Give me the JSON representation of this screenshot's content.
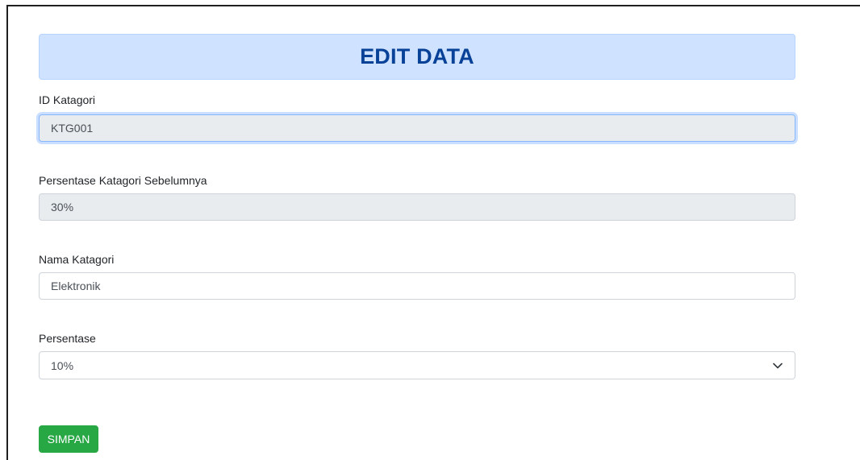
{
  "page": {
    "title": "EDIT DATA"
  },
  "form": {
    "id_kategori": {
      "label": "ID Katagori",
      "value": "KTG001"
    },
    "persentase_sebelumnya": {
      "label": "Persentase Katagori Sebelumnya",
      "value": "30%"
    },
    "nama_kategori": {
      "label": "Nama Katagori",
      "value": "Elektronik"
    },
    "persentase": {
      "label": "Persentase",
      "selected": "10%"
    },
    "submit_label": "SIMPAN"
  },
  "colors": {
    "banner_bg": "#cfe2ff",
    "banner_text": "#084298",
    "button_bg": "#28a745",
    "readonly_bg": "#e9ecef"
  },
  "icons": {
    "select_arrow": "chevron-down-icon"
  }
}
